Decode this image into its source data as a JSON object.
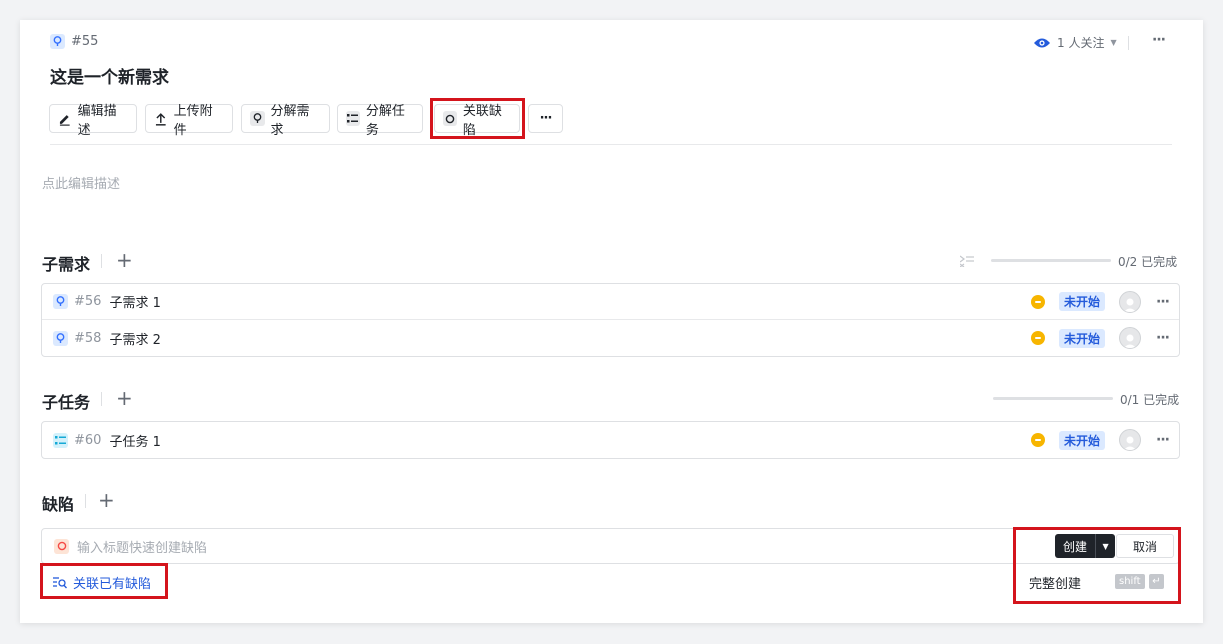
{
  "header": {
    "issue_number": "#55",
    "title": "这是一个新需求",
    "watchers": "1 人关注"
  },
  "toolbar": {
    "edit_desc": "编辑描述",
    "upload": "上传附件",
    "split_story": "分解需求",
    "split_task": "分解任务",
    "link_bug": "关联缺陷"
  },
  "description": {
    "placeholder": "点此编辑描述"
  },
  "sub_stories": {
    "title": "子需求",
    "progress": "0/2 已完成",
    "progress_fraction": 0,
    "items": [
      {
        "num": "#56",
        "title": "子需求 1",
        "status": "未开始"
      },
      {
        "num": "#58",
        "title": "子需求 2",
        "status": "未开始"
      }
    ]
  },
  "sub_tasks": {
    "title": "子任务",
    "progress": "0/1 已完成",
    "progress_fraction": 0,
    "items": [
      {
        "num": "#60",
        "title": "子任务 1",
        "status": "未开始"
      }
    ]
  },
  "bugs": {
    "title": "缺陷",
    "input_placeholder": "输入标题快速创建缺陷",
    "create_label": "创建",
    "cancel_label": "取消",
    "full_create": "完整创建",
    "shortcut": "shift",
    "shortcut_enter": "↵",
    "link_existing": "关联已有缺陷"
  },
  "colors": {
    "accent": "#245bdb",
    "highlight_box": "#d4141c",
    "priority": "#f7b500",
    "status_bg": "#dbe9ff"
  }
}
